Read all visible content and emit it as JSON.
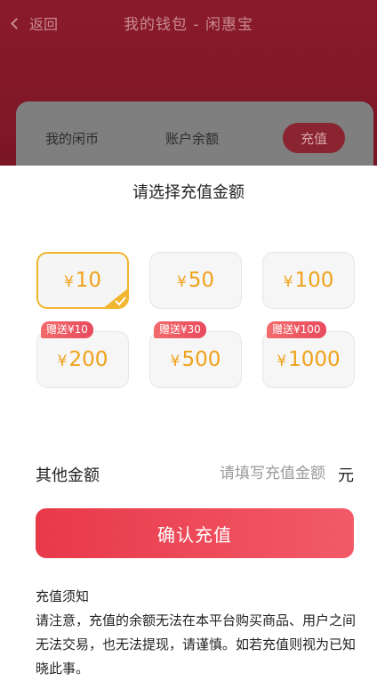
{
  "nav": {
    "back_label": "返回",
    "title": "我的钱包 - 闲惠宝"
  },
  "wallet": {
    "coin_label": "我的闲币",
    "balance_label": "账户余额",
    "recharge_label": "充值"
  },
  "sheet": {
    "title": "请选择充值金额",
    "currency_symbol": "¥",
    "amounts": [
      {
        "value": "10",
        "bonus": "",
        "selected": true
      },
      {
        "value": "50",
        "bonus": "",
        "selected": false
      },
      {
        "value": "100",
        "bonus": "",
        "selected": false
      },
      {
        "value": "200",
        "bonus": "赠送¥10",
        "selected": false
      },
      {
        "value": "500",
        "bonus": "赠送¥30",
        "selected": false
      },
      {
        "value": "1000",
        "bonus": "赠送¥100",
        "selected": false
      }
    ],
    "other_label": "其他金额",
    "other_placeholder": "请填写充值金额",
    "other_value": "",
    "unit": "元",
    "confirm_label": "确认充值",
    "notice_title": "充值须知",
    "notice_body": "请注意，充值的余额无法在本平台购买商品、用户之间无法交易，也无法提现，请谨慎。如若充值则视为已知晓此事。"
  },
  "colors": {
    "accent": "#e8394a",
    "amount_text": "#efa21a",
    "selected_border": "#f2b52f",
    "header_bg": "#8a1a2a"
  }
}
